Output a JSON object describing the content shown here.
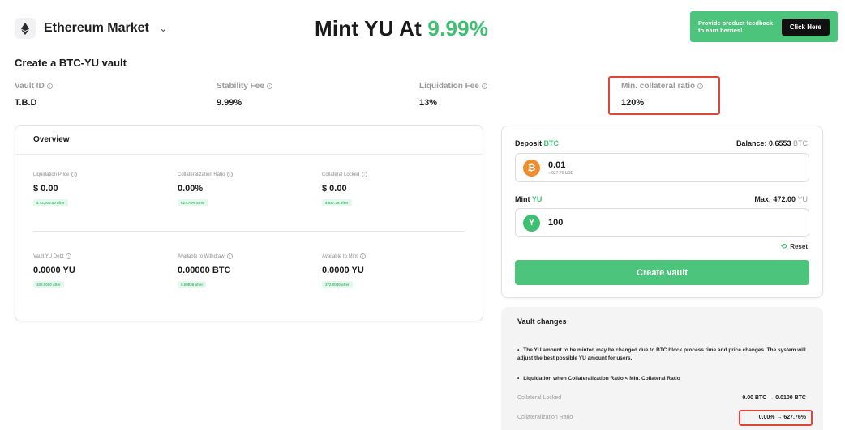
{
  "header": {
    "market_name": "Ethereum Market",
    "market_icon": "ethereum-icon",
    "hero_prefix": "Mint YU At ",
    "hero_rate": "9.99%"
  },
  "feedback": {
    "text": "Provide product feedback to earn berries!",
    "button": "Click Here",
    "bg_color": "#4cc47c"
  },
  "page_title": "Create a BTC-YU vault",
  "vault_info": [
    {
      "label": "Vault ID",
      "value": "T.B.D"
    },
    {
      "label": "Stability Fee",
      "value": "9.99%"
    },
    {
      "label": "Liquidation Fee",
      "value": "13%"
    },
    {
      "label": "Min. collateral ratio",
      "value": "120%"
    }
  ],
  "overview": {
    "title": "Overview",
    "stats": [
      {
        "label": "Liquidation Price",
        "value": "$ 0.00",
        "after": "$ 12,000.00 after"
      },
      {
        "label": "Collateralization Ratio",
        "value": "0.00%",
        "after": "627.76% after"
      },
      {
        "label": "Collateral Locked",
        "value": "$ 0.00",
        "after": "$ 627.76 after"
      },
      {
        "label": "Vault YU Debt",
        "value": "0.0000 YU",
        "after": "100.0000 after"
      },
      {
        "label": "Available to Withdraw",
        "value": "0.00000 BTC",
        "after": "0.00836 after"
      },
      {
        "label": "Available to Mint",
        "value": "0.0000 YU",
        "after": "372.0040 after"
      }
    ]
  },
  "deposit": {
    "label": "Deposit",
    "token": "BTC",
    "balance_label": "Balance: 0.6553",
    "balance_token": "BTC",
    "amount": "0.01",
    "amount_usd": "≈ 627.76 USD"
  },
  "mint": {
    "label": "Mint",
    "token": "YU",
    "max_label": "Max: 472.00",
    "max_token": "YU",
    "amount": "100"
  },
  "reset_label": "Reset",
  "create_button": "Create vault",
  "vault_changes": {
    "title": "Vault changes",
    "notes": [
      "The YU amount to be minted may be changed due to BTC block process time and price changes. The system will adjust the best possible YU amount for users.",
      "Liquidation when Collateralization Ratio < Min. Collateral Ratio"
    ],
    "rows": [
      {
        "label": "Collateral Locked",
        "value": "0.00 BTC → 0.0100 BTC"
      },
      {
        "label": "Collateralization Ratio",
        "value": "0.00% → 627.76%"
      }
    ]
  },
  "colors": {
    "accent": "#3fbf72",
    "highlight": "#e0453a",
    "btc": "#f08c2b"
  }
}
